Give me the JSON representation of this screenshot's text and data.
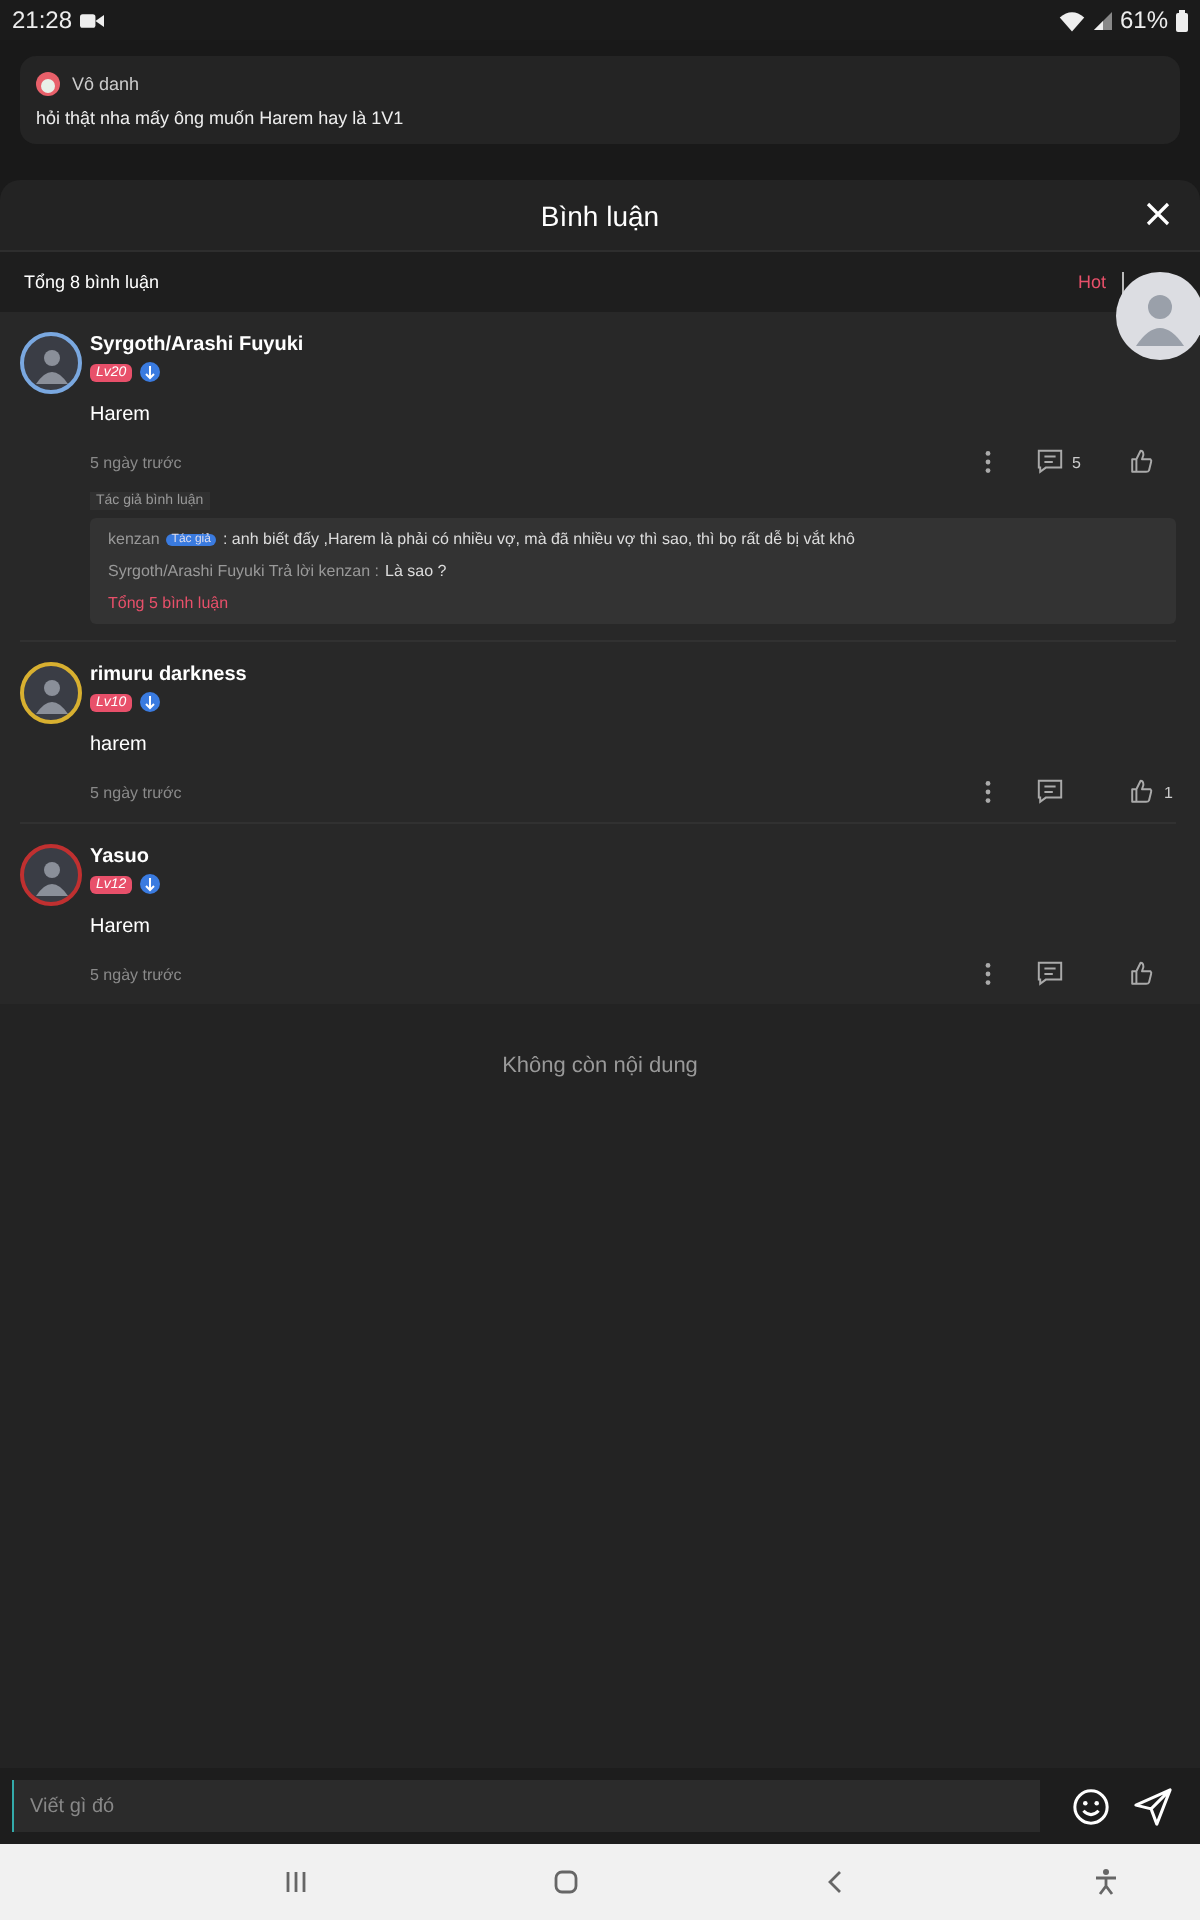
{
  "status_bar": {
    "time": "21:28",
    "battery": "61%"
  },
  "notification": {
    "sender": "Vô danh",
    "message": "hỏi thật nha mấy ông muốn Harem hay là 1V1"
  },
  "sheet": {
    "title": "Bình luận",
    "total": "Tổng 8 bình luận",
    "sort_tabs": [
      {
        "label": "Hot",
        "selected": true
      }
    ]
  },
  "comments": [
    {
      "user": "Syrgoth/Arashi Fuyuki",
      "level": "Lv20",
      "text": "Harem",
      "time": "5 ngày trước",
      "reply_count": "5",
      "author_label": "Tác giả bình luận",
      "replies": [
        {
          "name": "kenzan",
          "badge": "Tác giả",
          "text": ": anh biết đấy ,Harem là phải có nhiều vợ, mà đã nhiều vợ thì sao, thì bọ rất dễ bị vắt khô"
        },
        {
          "name": "Syrgoth/Arashi Fuyuki Trả lời kenzan :",
          "text": "Là sao ?"
        }
      ],
      "more": "Tổng 5 bình luận"
    },
    {
      "user": "rimuru darkness",
      "level": "Lv10",
      "text": "harem",
      "time": "5 ngày trước",
      "likes": "1"
    },
    {
      "user": "Yasuo",
      "level": "Lv12",
      "text": "Harem",
      "time": "5 ngày trước"
    }
  ],
  "end_text": "Không còn nội dung",
  "input": {
    "placeholder": "Viết gì đó"
  }
}
